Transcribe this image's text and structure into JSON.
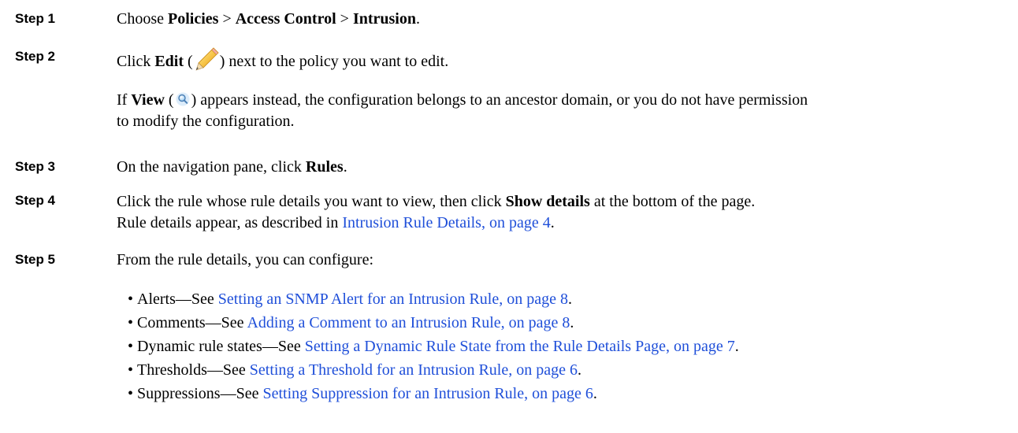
{
  "steps": [
    {
      "label": "Step 1",
      "pre": "Choose ",
      "b1": "Policies",
      "sep1": " > ",
      "b2": "Access Control",
      "sep2": " > ",
      "b3": "Intrusion",
      "post": "."
    },
    {
      "label": "Step 2",
      "pre": "Click ",
      "bold": "Edit",
      "open": " (",
      "close": ") next to the policy you want to edit.",
      "icon": "pencil-icon"
    },
    {
      "label": "Step 3",
      "pre": "On the navigation pane, click ",
      "bold": "Rules",
      "post": "."
    },
    {
      "label": "Step 4",
      "pre": "Click the rule whose rule details you want to view, then click ",
      "bold": "Show details",
      "post": " at the bottom of the page.",
      "line2_pre": "Rule details appear, as described in ",
      "link": "Intrusion Rule Details, on page 4",
      "line2_post": "."
    },
    {
      "label": "Step 5",
      "text": "From the rule details, you can configure:"
    }
  ],
  "note": {
    "pre": "If ",
    "bold": "View",
    "open": " (",
    "close": ") appears instead, the configuration belongs to an ancestor domain, or you do not have permission",
    "line2": "to modify the configuration.",
    "icon": "magnifier-icon"
  },
  "bullets": [
    {
      "bullet": "•",
      "lead": "Alerts—See ",
      "link": "Setting an SNMP Alert for an Intrusion Rule, on page 8",
      "tail": "."
    },
    {
      "bullet": "•",
      "lead": "Comments—See ",
      "link": "Adding a Comment to an Intrusion Rule, on page 8",
      "tail": "."
    },
    {
      "bullet": "•",
      "lead": "Dynamic rule states—See ",
      "link": "Setting a Dynamic Rule State from the Rule Details Page, on page 7",
      "tail": "."
    },
    {
      "bullet": "•",
      "lead": "Thresholds—See ",
      "link": "Setting a Threshold for an Intrusion Rule, on page 6",
      "tail": "."
    },
    {
      "bullet": "•",
      "lead": "Suppressions—See ",
      "link": "Setting Suppression for an Intrusion Rule, on page 6",
      "tail": "."
    }
  ],
  "colors": {
    "link": "#1f4fd9",
    "text": "#000000"
  }
}
